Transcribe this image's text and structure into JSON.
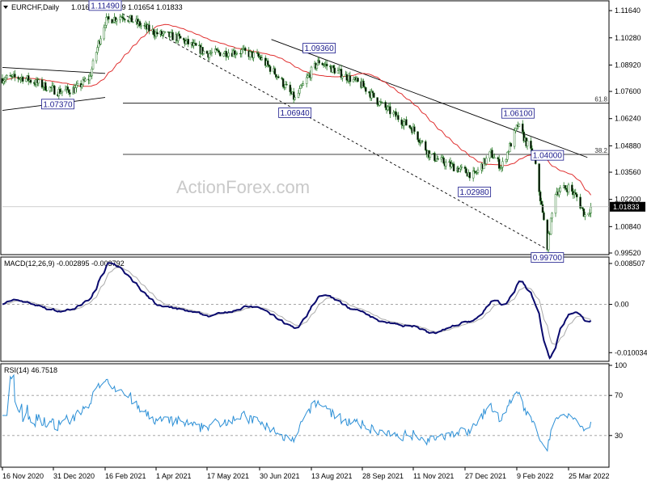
{
  "chart_data": [
    {
      "type": "candlestick",
      "symbol": "EURCHF,Daily",
      "ohlc_text": "1.01655 1.01989 1.01654 1.01833",
      "last_price": "1.01833",
      "ylim": [
        0.9952,
        1.1205
      ],
      "y_ticks": [
        "1.11640",
        "1.10280",
        "1.08920",
        "1.07600",
        "1.06240",
        "1.04880",
        "1.03560",
        "1.02200",
        "1.00840",
        "0.99520"
      ],
      "x_ticks": [
        "16 Nov 2020",
        "31 Dec 2020",
        "16 Feb 2021",
        "1 Apr 2021",
        "17 May 2021",
        "30 Jun 2021",
        "13 Aug 2021",
        "28 Sep 2021",
        "11 Nov 2021",
        "27 Dec 2021",
        "9 Feb 2022",
        "25 Mar 2022"
      ],
      "callouts": [
        {
          "text": "1.11490",
          "value": 1.1149,
          "date": "16 Feb 2021"
        },
        {
          "text": "1.07370",
          "value": 1.0737,
          "date": "4 Jan 2021"
        },
        {
          "text": "1.09360",
          "value": 1.0936,
          "date": "20 Aug 2021"
        },
        {
          "text": "1.06940",
          "value": 1.0694,
          "date": "30 Jul 2021"
        },
        {
          "text": "1.06100",
          "value": 1.061,
          "date": "10 Feb 2022"
        },
        {
          "text": "1.04000",
          "value": 1.04,
          "date": "7 Mar 2022"
        },
        {
          "text": "1.02980",
          "value": 1.0298,
          "date": "4 Jan 2022"
        },
        {
          "text": "0.99700",
          "value": 0.997,
          "date": "7 Mar 2022"
        }
      ],
      "fib_levels": [
        {
          "label": "61.8",
          "value": 1.0701
        },
        {
          "label": "38.2",
          "value": 1.0445
        }
      ],
      "series": [
        {
          "name": "price",
          "color": "#2a7a2a"
        },
        {
          "name": "moving average",
          "color": "#e03030"
        }
      ],
      "watermark": "ActionForex.com"
    },
    {
      "type": "line",
      "title": "MACD(12,26,9) -0.002895 -0.003792",
      "ylim": [
        -0.0115,
        0.0095
      ],
      "y_ticks": [
        "0.008507",
        "0.00",
        "-0.010034"
      ],
      "series": [
        {
          "name": "MACD",
          "color": "#0a0a6e"
        },
        {
          "name": "signal",
          "color": "#aaaaaa"
        }
      ],
      "zero_line": true
    },
    {
      "type": "line",
      "title": "RSI(14) 46.7518",
      "ylim": [
        0,
        100
      ],
      "y_ticks": [
        "100",
        "70",
        "30",
        "0"
      ],
      "series": [
        {
          "name": "RSI",
          "color": "#2b8fd6"
        }
      ]
    }
  ]
}
